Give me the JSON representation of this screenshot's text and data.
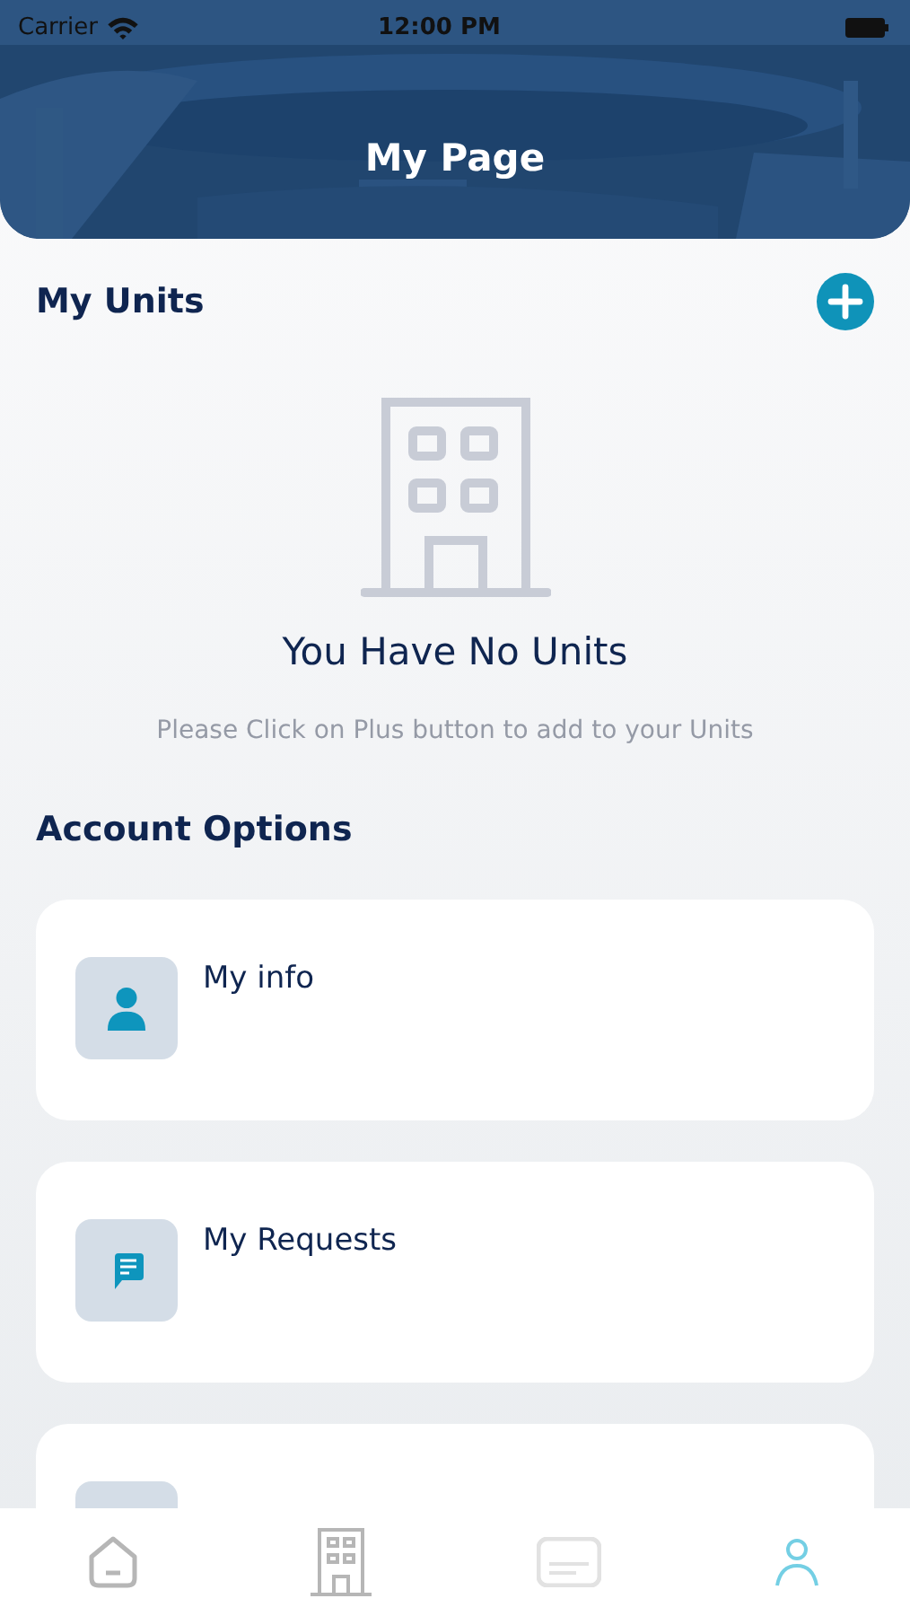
{
  "status_bar": {
    "carrier": "Carrier",
    "time": "12:00 PM"
  },
  "header": {
    "title": "My Page"
  },
  "units": {
    "title": "My Units",
    "empty_title": "You Have No Units",
    "empty_hint": "Please Click on Plus button to add to your Units"
  },
  "account_options": {
    "title": "Account Options",
    "items": [
      {
        "kind": "person",
        "title": "My info"
      },
      {
        "kind": "chat",
        "title": "My Requests"
      },
      {
        "kind": "blank"
      }
    ]
  },
  "tabs": [
    {
      "kind": "home",
      "selected": false
    },
    {
      "kind": "building",
      "selected": false
    },
    {
      "kind": "card",
      "selected": false
    },
    {
      "kind": "person",
      "selected": true
    }
  ]
}
